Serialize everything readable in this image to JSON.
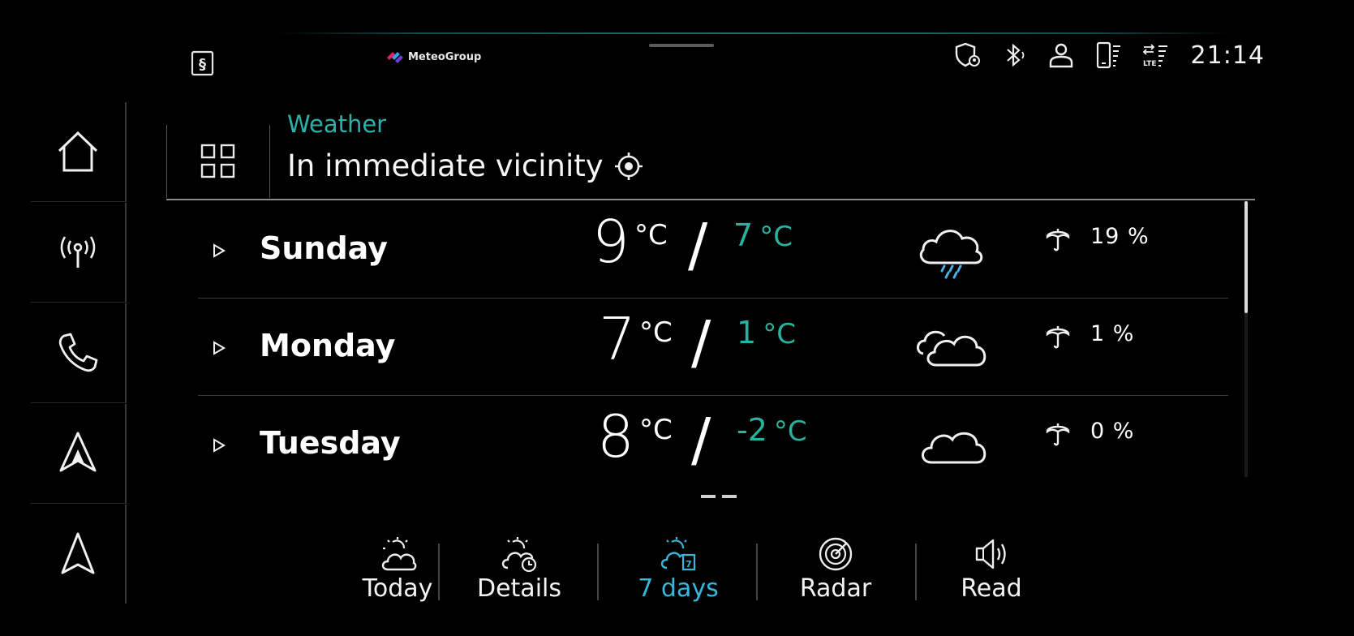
{
  "top_bar": {
    "brand": "MeteoGroup",
    "clock": "21:14",
    "status_icons": [
      "location-shield-icon",
      "bluetooth-icon",
      "user-profile-icon",
      "phone-signal-icon",
      "lte-signal-icon"
    ]
  },
  "left_nav": {
    "items": [
      "home-icon",
      "radio-icon",
      "phone-icon",
      "car-play-icon",
      "navigation-icon"
    ]
  },
  "header": {
    "app_label": "Weather",
    "location": "In immediate vicinity"
  },
  "forecast": [
    {
      "day": "Sunday",
      "high": "9",
      "low": "7",
      "unit": "°C",
      "condition": "rain-cloud-icon",
      "rain_chance": "19 %"
    },
    {
      "day": "Monday",
      "high": "7",
      "low": "1",
      "unit": "°C",
      "condition": "cloudy-icon",
      "rain_chance": "1 %"
    },
    {
      "day": "Tuesday",
      "high": "8",
      "low": "-2",
      "unit": "°C",
      "condition": "cloud-icon",
      "rain_chance": "0 %"
    }
  ],
  "tabs": [
    {
      "label": "Today",
      "icon": "sun-cloud-icon",
      "active": false
    },
    {
      "label": "Details",
      "icon": "sun-cloud-clock-icon",
      "active": false
    },
    {
      "label": "7 days",
      "icon": "sun-cloud-calendar-icon",
      "active": true
    },
    {
      "label": "Radar",
      "icon": "radar-icon",
      "active": false
    },
    {
      "label": "Read",
      "icon": "speaker-icon",
      "active": false
    }
  ],
  "colors": {
    "accent_teal": "#2ab2a9",
    "low_temp": "#2ab29e",
    "active_tab": "#36b7dc",
    "rain_drops": "#4ab0e6"
  }
}
